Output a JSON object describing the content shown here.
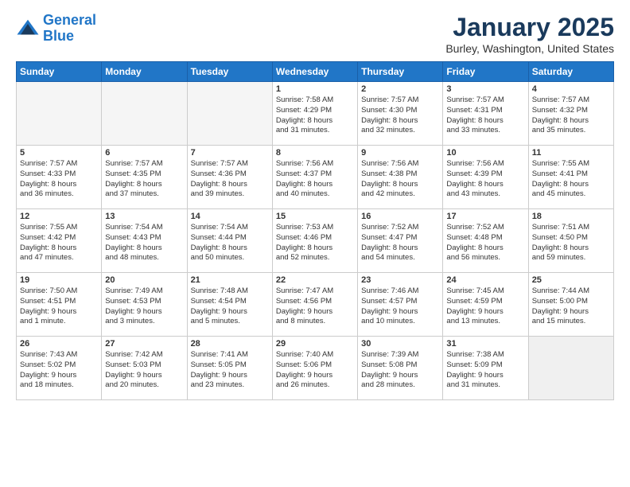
{
  "header": {
    "logo_line1": "General",
    "logo_line2": "Blue",
    "month": "January 2025",
    "location": "Burley, Washington, United States"
  },
  "days_of_week": [
    "Sunday",
    "Monday",
    "Tuesday",
    "Wednesday",
    "Thursday",
    "Friday",
    "Saturday"
  ],
  "weeks": [
    [
      {
        "day": "",
        "content": ""
      },
      {
        "day": "",
        "content": ""
      },
      {
        "day": "",
        "content": ""
      },
      {
        "day": "1",
        "content": "Sunrise: 7:58 AM\nSunset: 4:29 PM\nDaylight: 8 hours\nand 31 minutes."
      },
      {
        "day": "2",
        "content": "Sunrise: 7:57 AM\nSunset: 4:30 PM\nDaylight: 8 hours\nand 32 minutes."
      },
      {
        "day": "3",
        "content": "Sunrise: 7:57 AM\nSunset: 4:31 PM\nDaylight: 8 hours\nand 33 minutes."
      },
      {
        "day": "4",
        "content": "Sunrise: 7:57 AM\nSunset: 4:32 PM\nDaylight: 8 hours\nand 35 minutes."
      }
    ],
    [
      {
        "day": "5",
        "content": "Sunrise: 7:57 AM\nSunset: 4:33 PM\nDaylight: 8 hours\nand 36 minutes."
      },
      {
        "day": "6",
        "content": "Sunrise: 7:57 AM\nSunset: 4:35 PM\nDaylight: 8 hours\nand 37 minutes."
      },
      {
        "day": "7",
        "content": "Sunrise: 7:57 AM\nSunset: 4:36 PM\nDaylight: 8 hours\nand 39 minutes."
      },
      {
        "day": "8",
        "content": "Sunrise: 7:56 AM\nSunset: 4:37 PM\nDaylight: 8 hours\nand 40 minutes."
      },
      {
        "day": "9",
        "content": "Sunrise: 7:56 AM\nSunset: 4:38 PM\nDaylight: 8 hours\nand 42 minutes."
      },
      {
        "day": "10",
        "content": "Sunrise: 7:56 AM\nSunset: 4:39 PM\nDaylight: 8 hours\nand 43 minutes."
      },
      {
        "day": "11",
        "content": "Sunrise: 7:55 AM\nSunset: 4:41 PM\nDaylight: 8 hours\nand 45 minutes."
      }
    ],
    [
      {
        "day": "12",
        "content": "Sunrise: 7:55 AM\nSunset: 4:42 PM\nDaylight: 8 hours\nand 47 minutes."
      },
      {
        "day": "13",
        "content": "Sunrise: 7:54 AM\nSunset: 4:43 PM\nDaylight: 8 hours\nand 48 minutes."
      },
      {
        "day": "14",
        "content": "Sunrise: 7:54 AM\nSunset: 4:44 PM\nDaylight: 8 hours\nand 50 minutes."
      },
      {
        "day": "15",
        "content": "Sunrise: 7:53 AM\nSunset: 4:46 PM\nDaylight: 8 hours\nand 52 minutes."
      },
      {
        "day": "16",
        "content": "Sunrise: 7:52 AM\nSunset: 4:47 PM\nDaylight: 8 hours\nand 54 minutes."
      },
      {
        "day": "17",
        "content": "Sunrise: 7:52 AM\nSunset: 4:48 PM\nDaylight: 8 hours\nand 56 minutes."
      },
      {
        "day": "18",
        "content": "Sunrise: 7:51 AM\nSunset: 4:50 PM\nDaylight: 8 hours\nand 59 minutes."
      }
    ],
    [
      {
        "day": "19",
        "content": "Sunrise: 7:50 AM\nSunset: 4:51 PM\nDaylight: 9 hours\nand 1 minute."
      },
      {
        "day": "20",
        "content": "Sunrise: 7:49 AM\nSunset: 4:53 PM\nDaylight: 9 hours\nand 3 minutes."
      },
      {
        "day": "21",
        "content": "Sunrise: 7:48 AM\nSunset: 4:54 PM\nDaylight: 9 hours\nand 5 minutes."
      },
      {
        "day": "22",
        "content": "Sunrise: 7:47 AM\nSunset: 4:56 PM\nDaylight: 9 hours\nand 8 minutes."
      },
      {
        "day": "23",
        "content": "Sunrise: 7:46 AM\nSunset: 4:57 PM\nDaylight: 9 hours\nand 10 minutes."
      },
      {
        "day": "24",
        "content": "Sunrise: 7:45 AM\nSunset: 4:59 PM\nDaylight: 9 hours\nand 13 minutes."
      },
      {
        "day": "25",
        "content": "Sunrise: 7:44 AM\nSunset: 5:00 PM\nDaylight: 9 hours\nand 15 minutes."
      }
    ],
    [
      {
        "day": "26",
        "content": "Sunrise: 7:43 AM\nSunset: 5:02 PM\nDaylight: 9 hours\nand 18 minutes."
      },
      {
        "day": "27",
        "content": "Sunrise: 7:42 AM\nSunset: 5:03 PM\nDaylight: 9 hours\nand 20 minutes."
      },
      {
        "day": "28",
        "content": "Sunrise: 7:41 AM\nSunset: 5:05 PM\nDaylight: 9 hours\nand 23 minutes."
      },
      {
        "day": "29",
        "content": "Sunrise: 7:40 AM\nSunset: 5:06 PM\nDaylight: 9 hours\nand 26 minutes."
      },
      {
        "day": "30",
        "content": "Sunrise: 7:39 AM\nSunset: 5:08 PM\nDaylight: 9 hours\nand 28 minutes."
      },
      {
        "day": "31",
        "content": "Sunrise: 7:38 AM\nSunset: 5:09 PM\nDaylight: 9 hours\nand 31 minutes."
      },
      {
        "day": "",
        "content": ""
      }
    ]
  ]
}
